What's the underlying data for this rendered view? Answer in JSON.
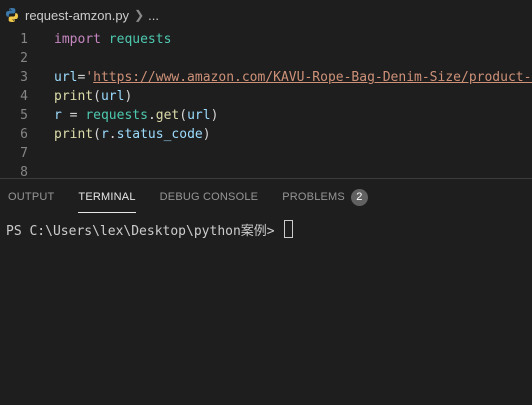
{
  "breadcrumb": {
    "filename": "request-amzon.py",
    "separator_icon": "chevron-right-icon",
    "ellipsis": "..."
  },
  "editor": {
    "lines": [
      {
        "number": "1",
        "tokens": [
          {
            "t": "import",
            "c": "kw"
          },
          {
            "t": " ",
            "c": "op"
          },
          {
            "t": "requests",
            "c": "mod"
          }
        ]
      },
      {
        "number": "2",
        "tokens": []
      },
      {
        "number": "3",
        "tokens": [
          {
            "t": "url",
            "c": "var"
          },
          {
            "t": "=",
            "c": "op"
          },
          {
            "t": "'",
            "c": "str"
          },
          {
            "t": "https://www.amazon.com/KAVU-Rope-Bag-Denim-Size/product-r",
            "c": "strlink"
          }
        ]
      },
      {
        "number": "4",
        "tokens": [
          {
            "t": "print",
            "c": "fn"
          },
          {
            "t": "(",
            "c": "op"
          },
          {
            "t": "url",
            "c": "var"
          },
          {
            "t": ")",
            "c": "op"
          }
        ]
      },
      {
        "number": "5",
        "tokens": [
          {
            "t": "r",
            "c": "var"
          },
          {
            "t": " = ",
            "c": "op"
          },
          {
            "t": "requests",
            "c": "mod"
          },
          {
            "t": ".",
            "c": "op"
          },
          {
            "t": "get",
            "c": "fn"
          },
          {
            "t": "(",
            "c": "op"
          },
          {
            "t": "url",
            "c": "var"
          },
          {
            "t": ")",
            "c": "op"
          }
        ]
      },
      {
        "number": "6",
        "tokens": [
          {
            "t": "print",
            "c": "fn"
          },
          {
            "t": "(",
            "c": "op"
          },
          {
            "t": "r",
            "c": "var"
          },
          {
            "t": ".",
            "c": "op"
          },
          {
            "t": "status_code",
            "c": "var"
          },
          {
            "t": ")",
            "c": "op"
          }
        ]
      },
      {
        "number": "7",
        "tokens": []
      },
      {
        "number": "8",
        "tokens": []
      }
    ]
  },
  "panel": {
    "tabs": [
      {
        "label": "OUTPUT",
        "active": false
      },
      {
        "label": "TERMINAL",
        "active": true
      },
      {
        "label": "DEBUG CONSOLE",
        "active": false
      },
      {
        "label": "PROBLEMS",
        "active": false
      }
    ],
    "problems_count": "2"
  },
  "terminal": {
    "prompt": "PS C:\\Users\\lex\\Desktop\\python案例> "
  },
  "colors": {
    "background": "#1e1e1e",
    "keyword": "#c586c0",
    "module": "#4ec9b0",
    "function": "#dcdcaa",
    "variable": "#9cdcfe",
    "string": "#ce9178"
  }
}
